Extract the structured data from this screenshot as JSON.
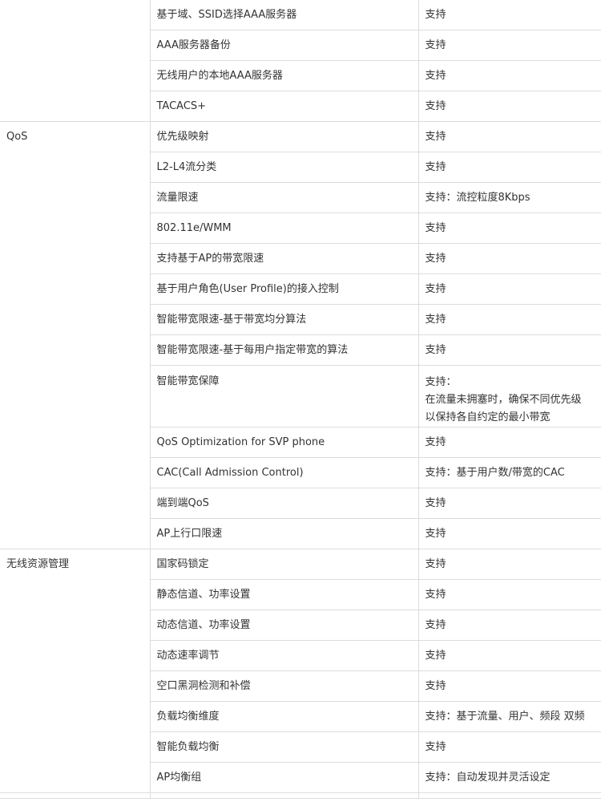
{
  "sections": [
    {
      "category": "",
      "rows": [
        {
          "feature": "基于域、SSID选择AAA服务器",
          "support": [
            "支持"
          ]
        },
        {
          "feature": "AAA服务器备份",
          "support": [
            "支持"
          ]
        },
        {
          "feature": "无线用户的本地AAA服务器",
          "support": [
            "支持"
          ]
        },
        {
          "feature": "TACACS+",
          "support": [
            "支持"
          ]
        }
      ]
    },
    {
      "category": "QoS",
      "rows": [
        {
          "feature": "优先级映射",
          "support": [
            "支持"
          ]
        },
        {
          "feature": "L2-L4流分类",
          "support": [
            "支持"
          ]
        },
        {
          "feature": "流量限速",
          "support": [
            "支持：流控粒度8Kbps"
          ]
        },
        {
          "feature": "802.11e/WMM",
          "support": [
            "支持"
          ]
        },
        {
          "feature": "支持基于AP的带宽限速",
          "support": [
            "支持"
          ]
        },
        {
          "feature": "基于用户角色(User Profile)的接入控制",
          "support": [
            "支持"
          ]
        },
        {
          "feature": "智能带宽限速-基于带宽均分算法",
          "support": [
            "支持"
          ]
        },
        {
          "feature": "智能带宽限速-基于每用户指定带宽的算法",
          "support": [
            "支持"
          ]
        },
        {
          "feature": "智能带宽保障",
          "support": [
            "支持：",
            "在流量未拥塞时，确保不同优先级",
            "以保持各自约定的最小带宽"
          ]
        },
        {
          "feature": "QoS Optimization for SVP phone",
          "support": [
            "支持"
          ]
        },
        {
          "feature": "CAC(Call Admission Control)",
          "support": [
            "支持：基于用户数/带宽的CAC"
          ]
        },
        {
          "feature": "端到端QoS",
          "support": [
            "支持"
          ]
        },
        {
          "feature": "AP上行口限速",
          "support": [
            "支持"
          ]
        }
      ]
    },
    {
      "category": "无线资源管理",
      "rows": [
        {
          "feature": "国家码锁定",
          "support": [
            "支持"
          ]
        },
        {
          "feature": "静态信道、功率设置",
          "support": [
            "支持"
          ]
        },
        {
          "feature": "动态信道、功率设置",
          "support": [
            "支持"
          ]
        },
        {
          "feature": "动态速率调节",
          "support": [
            "支持"
          ]
        },
        {
          "feature": "空口黑洞检测和补偿",
          "support": [
            "支持"
          ]
        },
        {
          "feature": "负载均衡维度",
          "support": [
            "支持：基于流量、用户、频段 双频"
          ]
        },
        {
          "feature": "智能负载均衡",
          "support": [
            "支持"
          ]
        },
        {
          "feature": "AP均衡组",
          "support": [
            "支持：自动发现并灵活设定"
          ]
        }
      ]
    }
  ]
}
